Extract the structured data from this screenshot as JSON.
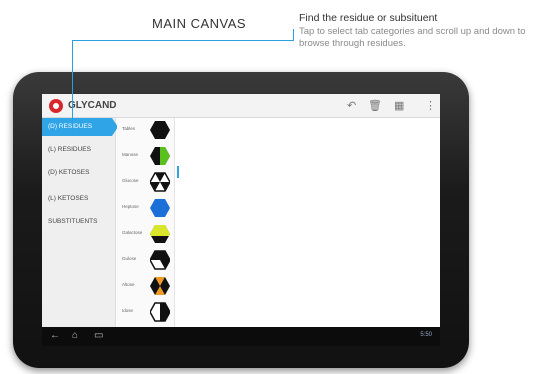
{
  "annotations": {
    "canvas_title": "MAIN CANVAS",
    "find_title": "Find the residue or subsituent",
    "find_desc": "Tap to select tab categories and scroll up and down to browse through residues."
  },
  "app": {
    "title": "GLYCAND",
    "actions": [
      {
        "name": "undo-icon",
        "glyph": "↶"
      },
      {
        "name": "delete-icon",
        "glyph": "🗑"
      },
      {
        "name": "save-icon",
        "glyph": "▦"
      },
      {
        "name": "overflow-icon",
        "glyph": "⋮"
      }
    ]
  },
  "tabs": [
    "(D) RESIDUES",
    "(L) RESIDUES",
    "(D) KETOSES",
    "(L) KETOSES",
    "SUBSTITUENTS"
  ],
  "active_tab": 0,
  "residues": [
    {
      "label": "Tables",
      "shape": "hex-black"
    },
    {
      "label": "Manose",
      "shape": "hex-half-green"
    },
    {
      "label": "Glucose",
      "shape": "hex-segments"
    },
    {
      "label": "Heptose",
      "shape": "hex-blue"
    },
    {
      "label": "Galactose",
      "shape": "hex-yellow-green"
    },
    {
      "label": "Gulose",
      "shape": "hex-black-white"
    },
    {
      "label": "Altose",
      "shape": "hex-black-orange"
    },
    {
      "label": "Idose",
      "shape": "hex-white-black"
    }
  ],
  "navbar": {
    "back_glyph": "←",
    "home_glyph": "⌂",
    "recents_glyph": "▭",
    "status": "5:50"
  },
  "colors": {
    "accent": "#2fa4e7",
    "brand": "#d8262c",
    "green": "#5ac01e",
    "blue": "#1a6fd8",
    "yellow": "#d9e62a",
    "orange": "#f09a28"
  }
}
